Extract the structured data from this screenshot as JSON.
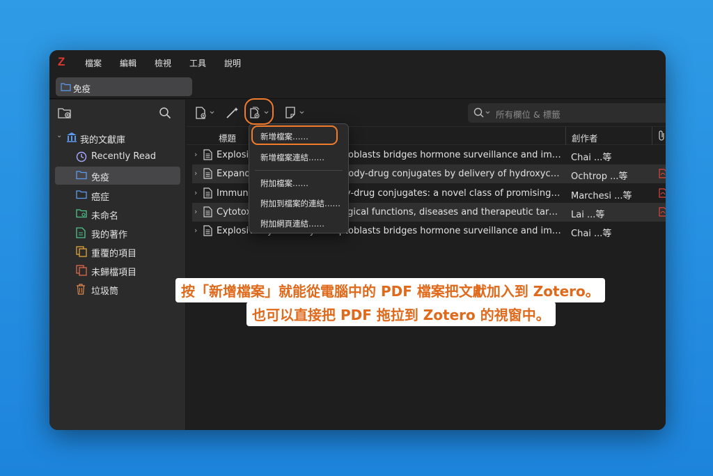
{
  "app": {
    "logo": "Z"
  },
  "menu": [
    "檔案",
    "編輯",
    "檢視",
    "工具",
    "說明"
  ],
  "tab": {
    "label": "免疫"
  },
  "sidebar": {
    "library_label": "我的文獻庫",
    "items": [
      {
        "label": "Recently Read",
        "icon": "clock-icon"
      },
      {
        "label": "免疫",
        "icon": "folder-icon",
        "selected": true
      },
      {
        "label": "癌症",
        "icon": "folder-icon"
      },
      {
        "label": "未命名",
        "icon": "feed-icon"
      },
      {
        "label": "我的著作",
        "icon": "document-icon"
      },
      {
        "label": "重覆的項目",
        "icon": "duplicate-icon"
      },
      {
        "label": "未歸檔項目",
        "icon": "unfiled-icon"
      },
      {
        "label": "垃圾筒",
        "icon": "trash-icon"
      }
    ]
  },
  "search": {
    "placeholder": "所有欄位 & 標籤"
  },
  "columns": {
    "title": "標題",
    "creator": "創作者"
  },
  "rows": [
    {
      "title": "Explosive cytotoxicity of ruptoblasts bridges hormone surveillance and immune defense",
      "creator": "Chai ...等",
      "has_pdf": false
    },
    {
      "title": "Expanding the utility of antibody-drug conjugates by delivery of hydroxychloroquine",
      "creator": "Ochtrop ...等",
      "has_pdf": true
    },
    {
      "title": "Immune-stimulating antibody-drug conjugates: a novel class of promising therapeutics",
      "creator": "Marchesi ...等",
      "has_pdf": true
    },
    {
      "title": "Cytotoxic lymphocytes: biological functions, diseases and therapeutic targets",
      "creator": "Lai ...等",
      "has_pdf": true
    },
    {
      "title": "Explosive cytotoxicity of ruptoblasts bridges hormone surveillance and immune defense",
      "creator": "Chai ...等",
      "has_pdf": false
    }
  ],
  "popup_menu": [
    "新增檔案……",
    "新增檔案連結……",
    "附加檔案……",
    "附加到檔案的連結……",
    "附加網頁連結……"
  ],
  "captions": [
    "按「新增檔案」就能從電腦中的 PDF 檔案把文獻加入到 Zotero。",
    "也可以直接把 PDF 拖拉到 Zotero 的視窗中。"
  ],
  "colors": {
    "highlight": "#f07c2c",
    "brand": "#d93a34",
    "folder": "#4f8fe6"
  }
}
